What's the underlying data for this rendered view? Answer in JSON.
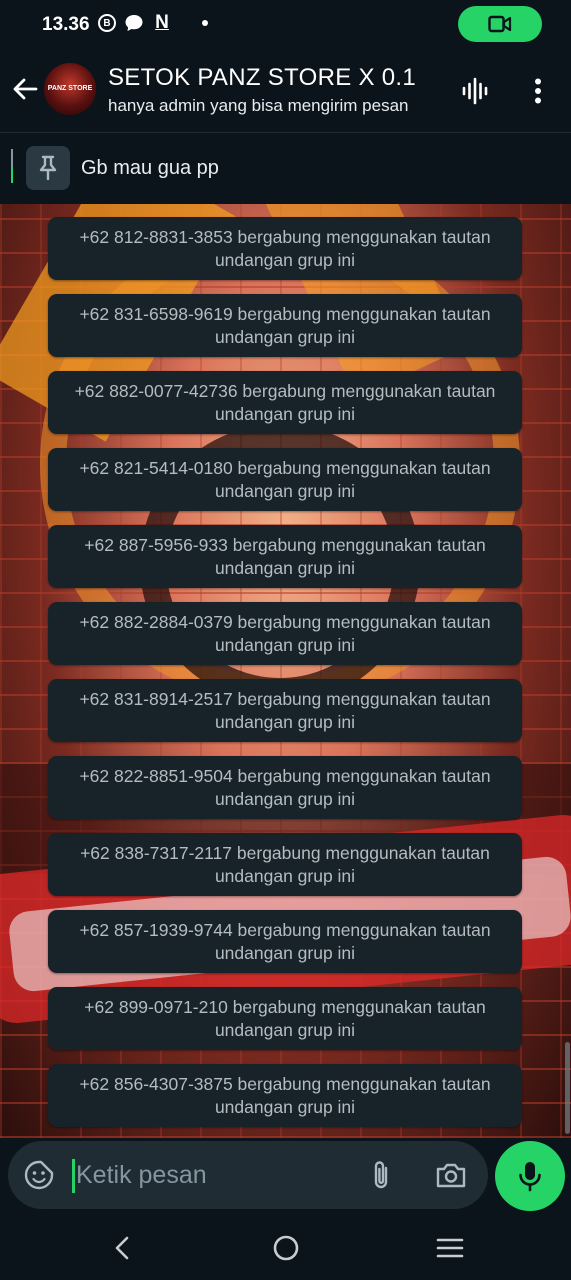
{
  "status_bar": {
    "time": "13.36",
    "icons": [
      "b-circle-icon",
      "chat-bubble-icon",
      "n-notification-icon",
      "dot-icon"
    ],
    "b_glyph": "B",
    "n_glyph": "N",
    "call_pill_color": "#25d366"
  },
  "header": {
    "title": "SETOK PANZ STORE X  0.1",
    "subtitle": "hanya admin yang bisa mengirim pesan",
    "avatar_text": "PANZ STORE"
  },
  "pinned": {
    "text": "Gb mau gua pp"
  },
  "messages": [
    {
      "text": "+62 812-8831-3853 bergabung menggunakan tautan undangan grup ini"
    },
    {
      "text": "+62 831-6598-9619 bergabung menggunakan tautan undangan grup ini"
    },
    {
      "text": "+62 882-0077-42736 bergabung menggunakan tautan undangan grup ini"
    },
    {
      "text": "+62 821-5414-0180 bergabung menggunakan tautan undangan grup ini"
    },
    {
      "text": "+62 887-5956-933 bergabung menggunakan tautan undangan grup ini"
    },
    {
      "text": "+62 882-2884-0379 bergabung menggunakan tautan undangan grup ini"
    },
    {
      "text": "+62 831-8914-2517 bergabung menggunakan tautan undangan grup ini"
    },
    {
      "text": "+62 822-8851-9504 bergabung menggunakan tautan undangan grup ini"
    },
    {
      "text": "+62 838-7317-2117 bergabung menggunakan tautan undangan grup ini"
    },
    {
      "text": "+62 857-1939-9744 bergabung menggunakan tautan undangan grup ini"
    },
    {
      "text": "+62 899-0971-210 bergabung menggunakan tautan undangan grup ini"
    },
    {
      "text": "+62 856-4307-3875 bergabung menggunakan tautan undangan grup ini"
    }
  ],
  "composer": {
    "placeholder": "Ketik pesan",
    "value": ""
  },
  "colors": {
    "accent": "#25d366",
    "background": "#0b141a",
    "bubble": "#182229"
  }
}
